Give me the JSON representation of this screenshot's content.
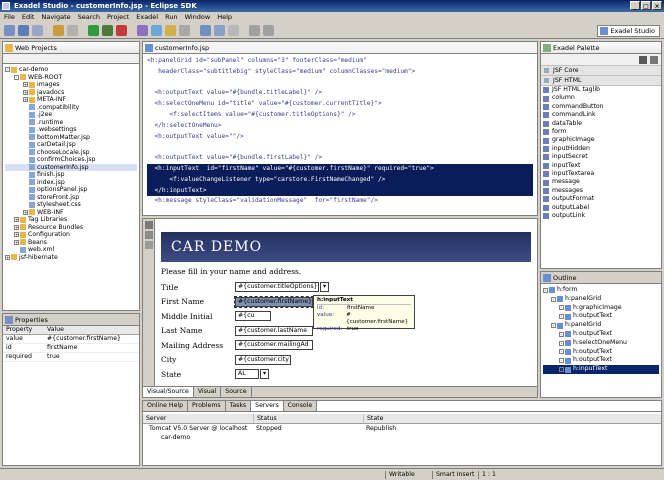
{
  "window": {
    "title": "Exadel Studio - customerInfo.jsp - Eclipse SDK"
  },
  "menu": [
    "File",
    "Edit",
    "Navigate",
    "Search",
    "Project",
    "Exadel",
    "Run",
    "Window",
    "Help"
  ],
  "perspective": "Exadel Studio",
  "web_projects": {
    "tab": "Web Projects",
    "items": [
      {
        "label": "car-demo",
        "depth": 0,
        "exp": "-"
      },
      {
        "label": "WEB-ROOT",
        "depth": 1,
        "exp": "-"
      },
      {
        "label": "images",
        "depth": 2,
        "exp": "+"
      },
      {
        "label": "javadocs",
        "depth": 2,
        "exp": "+"
      },
      {
        "label": "META-INF",
        "depth": 2,
        "exp": "+"
      },
      {
        "label": ".compatibility",
        "depth": 2,
        "exp": ""
      },
      {
        "label": ".j2ee",
        "depth": 2,
        "exp": ""
      },
      {
        "label": ".runtime",
        "depth": 2,
        "exp": ""
      },
      {
        "label": ".websettings",
        "depth": 2,
        "exp": ""
      },
      {
        "label": "bottomMatter.jsp",
        "depth": 2,
        "exp": ""
      },
      {
        "label": "carDetail.jsp",
        "depth": 2,
        "exp": ""
      },
      {
        "label": "chooseLocale.jsp",
        "depth": 2,
        "exp": ""
      },
      {
        "label": "confirmChoices.jsp",
        "depth": 2,
        "exp": ""
      },
      {
        "label": "customerInfo.jsp",
        "depth": 2,
        "exp": "",
        "selected": true
      },
      {
        "label": "finish.jsp",
        "depth": 2,
        "exp": ""
      },
      {
        "label": "index.jsp",
        "depth": 2,
        "exp": ""
      },
      {
        "label": "optionsPanel.jsp",
        "depth": 2,
        "exp": ""
      },
      {
        "label": "storeFront.jsp",
        "depth": 2,
        "exp": ""
      },
      {
        "label": "stylesheet.css",
        "depth": 2,
        "exp": ""
      },
      {
        "label": "WEB-INF",
        "depth": 2,
        "exp": "+"
      },
      {
        "label": "Tag Libraries",
        "depth": 1,
        "exp": "+"
      },
      {
        "label": "Resource Bundles",
        "depth": 1,
        "exp": "+"
      },
      {
        "label": "Configuration",
        "depth": 1,
        "exp": "+"
      },
      {
        "label": "Beans",
        "depth": 1,
        "exp": "+"
      },
      {
        "label": "web.xml",
        "depth": 1,
        "exp": ""
      },
      {
        "label": "jsf-hibernate",
        "depth": 0,
        "exp": "+"
      }
    ]
  },
  "properties": {
    "tab": "Properties",
    "headers": [
      "Property",
      "Value"
    ],
    "rows": [
      [
        "value",
        "#{customer.firstName}"
      ],
      [
        "id",
        "firstName"
      ],
      [
        "required",
        "true"
      ]
    ]
  },
  "editor": {
    "tab": "customerInfo.jsp",
    "lines": [
      "<h:panelGrid id=\"subPanel\" columns=\"3\" footerClass=\"medium\"",
      "   headerClass=\"subtitlebig\" styleClass=\"medium\" columnClasses=\"medium\">",
      "",
      "  <h:outputText value=\"#{bundle.titleLabel}\" />",
      "  <h:selectOneMenu id=\"title\" value=\"#{customer.currentTitle}\">",
      "      <f:selectItems value=\"#{customer.titleOptions}\" />",
      "  </h:selectOneMenu>",
      "  <h:outputText value=\"\"/>",
      "",
      "  <h:outputText value=\"#{bundle.firstLabel}\" />",
      "  <h:inputText  id=\"firstName\" value=\"#{customer.firstName}\" required=\"true\">",
      "      <f:valueChangeListener type=\"carstore.FirstNameChanged\" />",
      "  </h:inputText>",
      "  <h:message styleClass=\"validationMessage\"  for=\"firstName\"/>",
      "",
      "  <h:outputText value=\"#{bundle.middleLabel}\" />"
    ],
    "selected_lines": [
      10,
      11,
      12
    ]
  },
  "visual": {
    "banner": "CAR DEMO",
    "intro": "Please fill in your name and address.",
    "rows": [
      {
        "label": "Title",
        "value": "#{customer.titleOptions}",
        "kind": "select"
      },
      {
        "label": "First Name",
        "value": "#{customer.firstName}",
        "kind": "input",
        "selected": true
      },
      {
        "label": "Middle Initial",
        "value": "#{cu",
        "kind": "input"
      },
      {
        "label": "Last Name",
        "value": "#{customer.lastName",
        "kind": "input"
      },
      {
        "label": "Mailing Address",
        "value": "#{customer.mailingAd",
        "kind": "input"
      },
      {
        "label": "City",
        "value": "#{customer.city}",
        "kind": "input"
      },
      {
        "label": "State",
        "value": "AL",
        "kind": "select"
      }
    ],
    "tooltip": {
      "title": "h:inputText",
      "rows": [
        [
          "id:",
          "firstName"
        ],
        [
          "value:",
          "#{customer.firstName}"
        ],
        [
          "required:",
          "true"
        ]
      ]
    },
    "tabs": [
      "Visual/Source",
      "Visual",
      "Source"
    ]
  },
  "palette": {
    "tab": "Exadel Palette",
    "groups": [
      "JSF Core",
      "JSF HTML"
    ],
    "items": [
      "JSF HTML taglib",
      "column",
      "commandButton",
      "commandLink",
      "dataTable",
      "form",
      "graphicImage",
      "inputHidden",
      "inputSecret",
      "inputText",
      "inputTextarea",
      "message",
      "messages",
      "outputFormat",
      "outputLabel",
      "outputLink"
    ]
  },
  "outline": {
    "tab": "Outline",
    "items": [
      {
        "label": "h:form",
        "depth": 0
      },
      {
        "label": "h:panelGrid",
        "depth": 1
      },
      {
        "label": "h:graphicImage",
        "depth": 2
      },
      {
        "label": "h:outputText",
        "depth": 2
      },
      {
        "label": "h:panelGrid",
        "depth": 1
      },
      {
        "label": "h:outputText",
        "depth": 2
      },
      {
        "label": "h:selectOneMenu",
        "depth": 2
      },
      {
        "label": "h:outputText",
        "depth": 2
      },
      {
        "label": "h:outputText",
        "depth": 2
      },
      {
        "label": "h:inputText",
        "depth": 2,
        "selected": true
      }
    ]
  },
  "bottom": {
    "tabs": [
      "Online Help",
      "Problems",
      "Tasks",
      "Servers",
      "Console"
    ],
    "active": "Servers",
    "headers": [
      "Server",
      "Status",
      "State"
    ],
    "rows": [
      {
        "server": "Tomcat V5.0 Server @ localhost",
        "status": "Stopped",
        "state": "Republish"
      },
      {
        "server": "car-demo",
        "status": "",
        "state": ""
      }
    ]
  },
  "statusbar": [
    "Writable",
    "Smart Insert",
    "1 : 1"
  ]
}
